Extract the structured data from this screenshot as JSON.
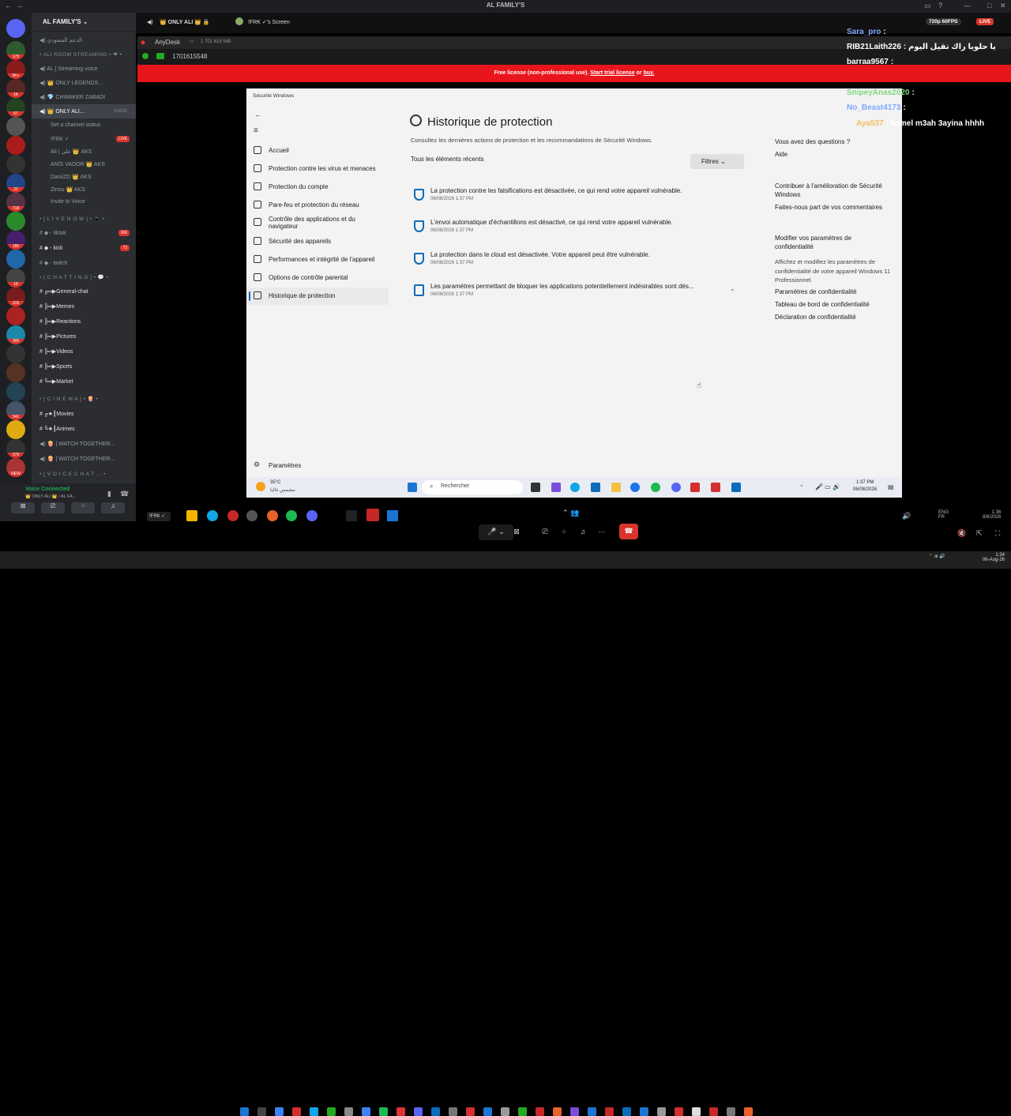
{
  "window": {
    "title": "AL FAMILY'S"
  },
  "discord": {
    "server_name": "AL FAMILY'S",
    "channels": [
      {
        "label": "الدعم السعودي",
        "type": "voice"
      },
      {
        "label": "• ALI ROOM STREAMING • ❤ •",
        "type": "cat"
      },
      {
        "label": "AL | Streaming voice",
        "type": "voice"
      },
      {
        "label": "👑 ONLY LEGENDS...",
        "type": "voice"
      },
      {
        "label": "💎 CHWAKER ZABADI",
        "type": "voice"
      },
      {
        "label": "👑 ONLY ALI...",
        "type": "voice",
        "active": true,
        "time": "5:16:21"
      },
      {
        "label": "Set a channel status",
        "type": "sub"
      },
      {
        "label": "!FRK ✓",
        "type": "member",
        "badge": "LIVE"
      },
      {
        "label": "Ali | علي 👑 AKS",
        "type": "member"
      },
      {
        "label": "ANÏS VADOR 👑 AKS",
        "type": "member"
      },
      {
        "label": "DaniiZD 👑 AKS",
        "type": "member"
      },
      {
        "label": "Zinou 👑 AKS",
        "type": "member"
      },
      {
        "label": "Invite to Voice",
        "type": "sub"
      },
      {
        "label": "• [ L I V E  N O W ] • 📱 •",
        "type": "cat"
      },
      {
        "label": "◆ - tiktok",
        "type": "text",
        "count": "106"
      },
      {
        "label": "◆ - kick",
        "type": "text",
        "count": "73",
        "on": true
      },
      {
        "label": "◆ - twitch",
        "type": "text"
      },
      {
        "label": "• [ C H A T T I N G ] • 💬 •",
        "type": "cat"
      },
      {
        "label": "╔═▶General-chat",
        "type": "text",
        "on": true
      },
      {
        "label": "╠═▶Memes",
        "type": "text",
        "on": true
      },
      {
        "label": "╠═▶Reactions",
        "type": "text",
        "on": true
      },
      {
        "label": "╠═▶Pictures",
        "type": "text",
        "on": true
      },
      {
        "label": "╠═▶Videos",
        "type": "text",
        "on": true
      },
      {
        "label": "╠═▶Sports",
        "type": "text",
        "on": true
      },
      {
        "label": "╚═▶Market",
        "type": "text",
        "on": true
      },
      {
        "label": "• [ C I N E M A ] • 🍿 •",
        "type": "cat"
      },
      {
        "label": "╔★┃Movies",
        "type": "text",
        "on": true
      },
      {
        "label": "╚★┃Animes",
        "type": "text",
        "on": true
      },
      {
        "label": "🍿 | WATCH TOGETHER...",
        "type": "voice"
      },
      {
        "label": "🍿 | WATCH TOGETHER...",
        "type": "voice"
      },
      {
        "label": "• [ V O I C E  C H A T ... •",
        "type": "cat"
      }
    ],
    "voice_status": "Voice Connected",
    "voice_channel": "👑 ONLY ALI 👑 / AL FA...",
    "user_name": "Ali | علي",
    "user_status": "يعني المشاكل..."
  },
  "stream_header": {
    "channel": "👑 ONLY ALI 👑 🔒",
    "screen": "!FRK ✓'s Screen",
    "quality": "720p 60FPS",
    "live": "LIVE"
  },
  "anydesk": {
    "app": "AnyDesk",
    "id_tab": "1 701 615 548",
    "address": "1701615548",
    "license_text": "Free license (non-professional use).",
    "license_link": "Start trial license",
    "or": "or",
    "buy": "buy."
  },
  "security": {
    "app_title": "Sécurité Windows",
    "page_title": "Historique de protection",
    "subtitle": "Consultez les dernières actions de protection et les recommandations de Sécurité Windows.",
    "filter_label": "Tous les éléments récents",
    "filter_button": "Filtres",
    "nav": [
      {
        "label": "Accueil"
      },
      {
        "label": "Protection contre les virus et menaces"
      },
      {
        "label": "Protection du compte"
      },
      {
        "label": "Pare-feu et protection du réseau"
      },
      {
        "label": "Contrôle des applications et du navigateur"
      },
      {
        "label": "Sécurité des appareils"
      },
      {
        "label": "Performances et intégrité de l'appareil"
      },
      {
        "label": "Options de contrôle parental"
      },
      {
        "label": "Historique de protection"
      }
    ],
    "settings": "Paramètres",
    "entries": [
      {
        "text": "La protection contre les falsifications est désactivée, ce qui rend votre appareil vulnérable.",
        "date": "06/08/2026 1:37 PM"
      },
      {
        "text": "L'envoi automatique d'échantillons est désactivé, ce qui rend votre appareil vulnérable.",
        "date": "06/08/2026 1:37 PM"
      },
      {
        "text": "La protection dans le cloud est désactivée. Votre appareil peut être vulnérable.",
        "date": "06/08/2026 1:37 PM"
      },
      {
        "text": "Les paramètres permettant de bloquer les applications potentiellement indésirables sont dés...",
        "date": "06/08/2026 1:37 PM"
      }
    ],
    "right": {
      "q_title": "Vous avez des questions ?",
      "q_link": "Aide",
      "c_title": "Contribuer à l'amélioration de Sécurité Windows",
      "c_link": "Faites-nous part de vos commentaires",
      "p_title": "Modifier vos paramètres de confidentialité",
      "p_text": "Affichez et modifiez les paramètres de confidentialité de votre appareil Windows 11 Professionnel.",
      "p_links": [
        "Paramètres de confidentialité",
        "Tableau de bord de confidentialité",
        "Déclaration de confidentialité"
      ]
    }
  },
  "remote_taskbar": {
    "weather_temp": "35°C",
    "weather_desc": "مشمس غالبا",
    "search": "Rechercher",
    "time": "1:37 PM",
    "date": "06/08/2026"
  },
  "stream_controls": {
    "user": "!FRK ✓"
  },
  "chat_overlay": [
    {
      "user": "Sara_pro",
      "msg": ":"
    },
    {
      "user": "RIB21Laith226",
      "msg": ": يا حلويا راك تقيل اليوم"
    },
    {
      "user": "barraa9567",
      "msg": ":"
    },
    {
      "user": "SnipeyAnas2020",
      "msg": ":"
    },
    {
      "user": "No_Beast4173",
      "msg": ":"
    },
    {
      "user": "Aya537",
      "msg": ": kamel m3ah 3ayina hhhh"
    }
  ],
  "host_taskbar": {
    "lang": "ENG",
    "lang2": "FR",
    "time": "1:34",
    "date": "06-Aug-26",
    "time2": "1:36",
    "date2": "8/6/2026"
  }
}
